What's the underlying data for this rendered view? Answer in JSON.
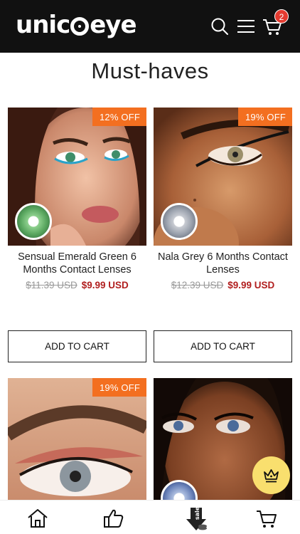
{
  "header": {
    "logo": "unicoeye",
    "cart_count": "2"
  },
  "section_title": "Must-haves",
  "products": [
    {
      "discount": "12% OFF",
      "name": "Sensual Emerald Green 6 Months Contact Lenses",
      "old_price": "$11.39 USD",
      "price": "$9.99 USD",
      "cta": "ADD TO CART"
    },
    {
      "discount": "19% OFF",
      "name": "Nala Grey 6 Months Contact Lenses",
      "old_price": "$12.39 USD",
      "price": "$9.99 USD",
      "cta": "ADD TO CART"
    },
    {
      "discount": "19% OFF"
    },
    {}
  ],
  "icons": {
    "search": "search-icon",
    "menu": "menu-icon",
    "cart": "cart-icon",
    "home": "home-icon",
    "like": "thumbs-up-icon",
    "sale": "sale-icon",
    "bottom_cart": "cart-icon",
    "crown": "crown-icon"
  },
  "sale_label": "sale",
  "colors": {
    "header_bg": "#111111",
    "discount": "#f36f20",
    "price": "#b11f1f",
    "badge": "#e33a2f",
    "crown_button": "#f9df6e"
  }
}
